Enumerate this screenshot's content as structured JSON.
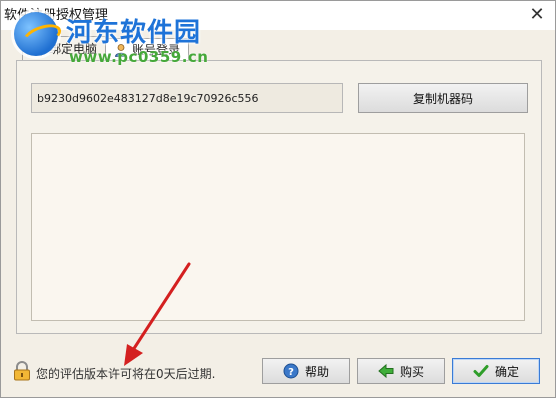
{
  "window": {
    "title": "软件注册授权管理",
    "close_label": "✕"
  },
  "watermark": {
    "site": "河东软件园",
    "url": "www.pc0359.cn"
  },
  "tabs": [
    {
      "label": "绑定电脑",
      "icon": "computer-icon",
      "active": true
    },
    {
      "label": "账号登录",
      "icon": "user-icon",
      "active": false
    }
  ],
  "machine": {
    "code": "b9230d9602e483127d8e19c70926c556",
    "copy_label": "复制机器码"
  },
  "status": {
    "message": "您的评估版本许可将在0天后过期."
  },
  "buttons": {
    "help": "帮助",
    "buy": "购买",
    "ok": "确定"
  },
  "colors": {
    "arrow": "#d42020",
    "accent": "#3a7bd5"
  }
}
